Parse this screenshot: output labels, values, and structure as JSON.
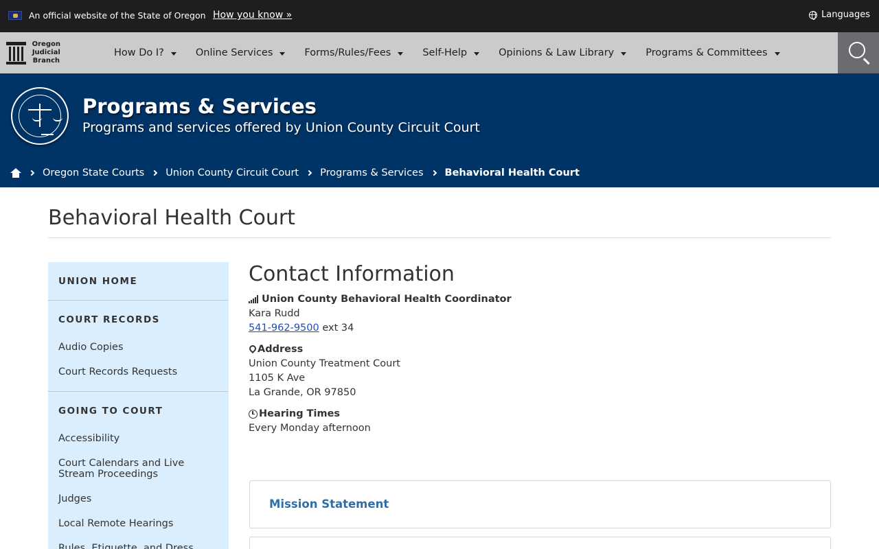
{
  "official_bar": {
    "text": "An official website of the State of Oregon",
    "how_you_know": "How you know »",
    "languages": "Languages"
  },
  "nav": {
    "logo_text": [
      "Oregon",
      "Judicial",
      "Branch"
    ],
    "items": [
      {
        "label": "How Do I?"
      },
      {
        "label": "Online Services"
      },
      {
        "label": "Forms/Rules/Fees"
      },
      {
        "label": "Self-Help"
      },
      {
        "label": "Opinions & Law Library"
      },
      {
        "label": "Programs & Committees"
      }
    ]
  },
  "header": {
    "title": "Programs & Services",
    "subtitle": "Programs and services offered by Union County Circuit Court"
  },
  "breadcrumb": {
    "items": [
      "Oregon State Courts",
      "Union County Circuit Court",
      "Programs & Services"
    ],
    "current": "Behavioral Health Court"
  },
  "page": {
    "title": "Behavioral Health Court"
  },
  "sidebar": {
    "home": "UNION HOME",
    "sections": [
      {
        "heading": "COURT RECORDS",
        "links": [
          "Audio Copies",
          "Court Records Requests"
        ]
      },
      {
        "heading": "GOING TO COURT",
        "links": [
          "Accessibility",
          "Court Calendars and Live Stream Proceedings",
          "Judges",
          "Local Remote Hearings",
          "Rules, Etiquette, and Dress Code"
        ]
      }
    ]
  },
  "contact": {
    "title": "Contact Information",
    "coordinator_label": "Union County Behavioral Health Coordinator",
    "coordinator_name": "Kara Rudd",
    "phone": "541-962-9500",
    "phone_ext": "ext 34",
    "address_label": "Address",
    "address_lines": [
      "Union County Treatment Court",
      "1105 K Ave",
      "La Grande, OR 97850"
    ],
    "hearing_label": "Hearing Times",
    "hearing_text": "Every Monday afternoon"
  },
  "cards": [
    {
      "title": "Mission Statement"
    }
  ],
  "colors": {
    "official_bar": "#1e1e1e",
    "nav_bg": "#c9cbcd",
    "header_bg": "#003366",
    "sidebar_bg": "#dbeefd",
    "link": "#1a4fbf",
    "card_title": "#2f6ea8"
  }
}
